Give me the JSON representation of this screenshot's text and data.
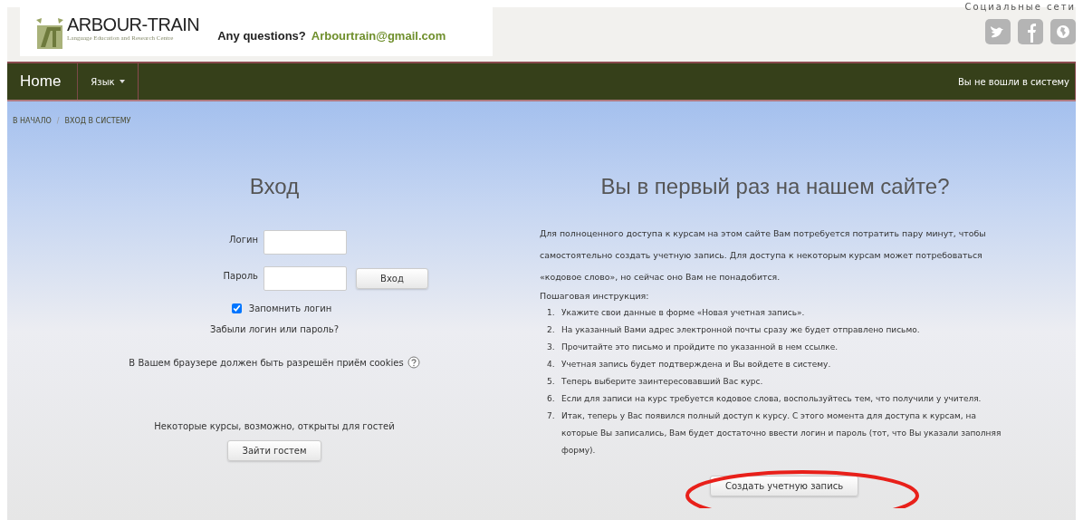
{
  "header": {
    "brand": "ARBOUR-TRAIN",
    "tagline": "Language Education and Research Centre",
    "question": "Any questions?",
    "email": "Arbourtrain@gmail.com",
    "social_title": "Социальные сети",
    "social_links": [
      {
        "kind": "bird"
      },
      {
        "kind": "f"
      },
      {
        "kind": "globe"
      }
    ]
  },
  "nav": {
    "items": [
      {
        "label": "Home",
        "kind": "home"
      },
      {
        "label": "Язык",
        "kind": "dropdown"
      }
    ],
    "login_status": "Вы не вошли в систему"
  },
  "breadcrumb": {
    "items": [
      "В НАЧАЛО",
      "ВХОД В СИСТЕМУ"
    ],
    "separator": "/"
  },
  "login": {
    "title": "Вход",
    "fields": [
      {
        "label": "Логин"
      },
      {
        "label": "Пароль"
      }
    ],
    "submit": "Вход",
    "remember": {
      "label": "Запомнить логин",
      "checked": true
    },
    "forgot": "Забыли логин или пароль?",
    "cookies": "В Вашем браузере должен быть разрешён приём cookies",
    "guest_note": "Некоторые курсы, возможно, открыты для гостей",
    "guest_button": "Зайти гостем"
  },
  "signup": {
    "title": "Вы в первый раз на нашем сайте?",
    "intro": "Для полноценного доступа к курсам на этом сайте Вам потребуется потратить пару минут, чтобы самостоятельно создать учетную запись. Для доступа к некоторым курсам может потребоваться «кодовое слово», но сейчас оно Вам не понадобится.",
    "steps_title": "Пошаговая инструкция:",
    "steps": [
      {
        "number": "1.",
        "text": "Укажите свои данные в форме «Новая учетная запись»."
      },
      {
        "number": "2.",
        "text": "На указанный Вами адрес электронной почты сразу же будет отправлено письмо."
      },
      {
        "number": "3.",
        "text": "Прочитайте это письмо и пройдите по указанной в нем ссылке."
      },
      {
        "number": "4.",
        "text": "Учетная запись будет подтверждена и Вы войдете в систему."
      },
      {
        "number": "5.",
        "text": "Теперь выберите заинтересовавший Вас курс."
      },
      {
        "number": "6.",
        "text": "Если для записи на курс требуется кодовое слова, воспользуйтесь тем, что получили у учителя."
      },
      {
        "number": "7.",
        "text": "Итак, теперь у Вас появился полный доступ к курсу. С этого момента для доступа к курсам, на которые Вы записались, Вам будет достаточно ввести логин и пароль (тот, что Вы указали заполняя форму)."
      }
    ],
    "button": "Создать учетную запись",
    "highlighted": true
  }
}
